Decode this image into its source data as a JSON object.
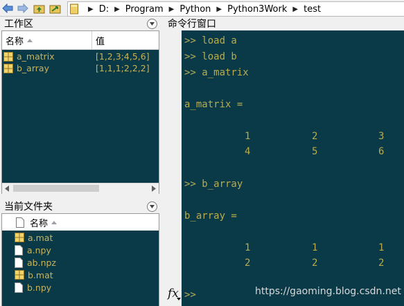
{
  "toolbar": {
    "path": [
      "D:",
      "Program",
      "Python",
      "Python3Work",
      "test"
    ]
  },
  "workspace": {
    "title": "工作区",
    "col_name": "名称",
    "col_value": "值",
    "vars": [
      {
        "name": "a_matrix",
        "value": "[1,2,3;4,5,6]"
      },
      {
        "name": "b_array",
        "value": "[1,1,1;2,2,2]"
      }
    ]
  },
  "current_folder": {
    "title": "当前文件夹",
    "col_name": "名称",
    "files": [
      {
        "name": "a.mat",
        "icon": "mat-file-icon"
      },
      {
        "name": "a.npy",
        "icon": "file-icon"
      },
      {
        "name": "ab.npz",
        "icon": "file-icon"
      },
      {
        "name": "b.mat",
        "icon": "mat-file-icon"
      },
      {
        "name": "b.npy",
        "icon": "file-icon"
      }
    ]
  },
  "command_window": {
    "title": "命令行窗口",
    "lines": [
      ">> load a",
      ">> load b",
      ">> a_matrix",
      "a_matrix =",
      ">> b_array",
      "b_array ="
    ],
    "a_matrix": [
      [
        "1",
        "2",
        "3"
      ],
      [
        "4",
        "5",
        "6"
      ]
    ],
    "b_array": [
      [
        "1",
        "1",
        "1"
      ],
      [
        "2",
        "2",
        "2"
      ]
    ],
    "prompt": ">>",
    "fx": "fx"
  },
  "watermark": "https://gaoming.blog.csdn.net",
  "colors": {
    "panel_bg": "#0a3a47",
    "text_gold": "#c9b35a",
    "chrome": "#f0f0f0"
  }
}
